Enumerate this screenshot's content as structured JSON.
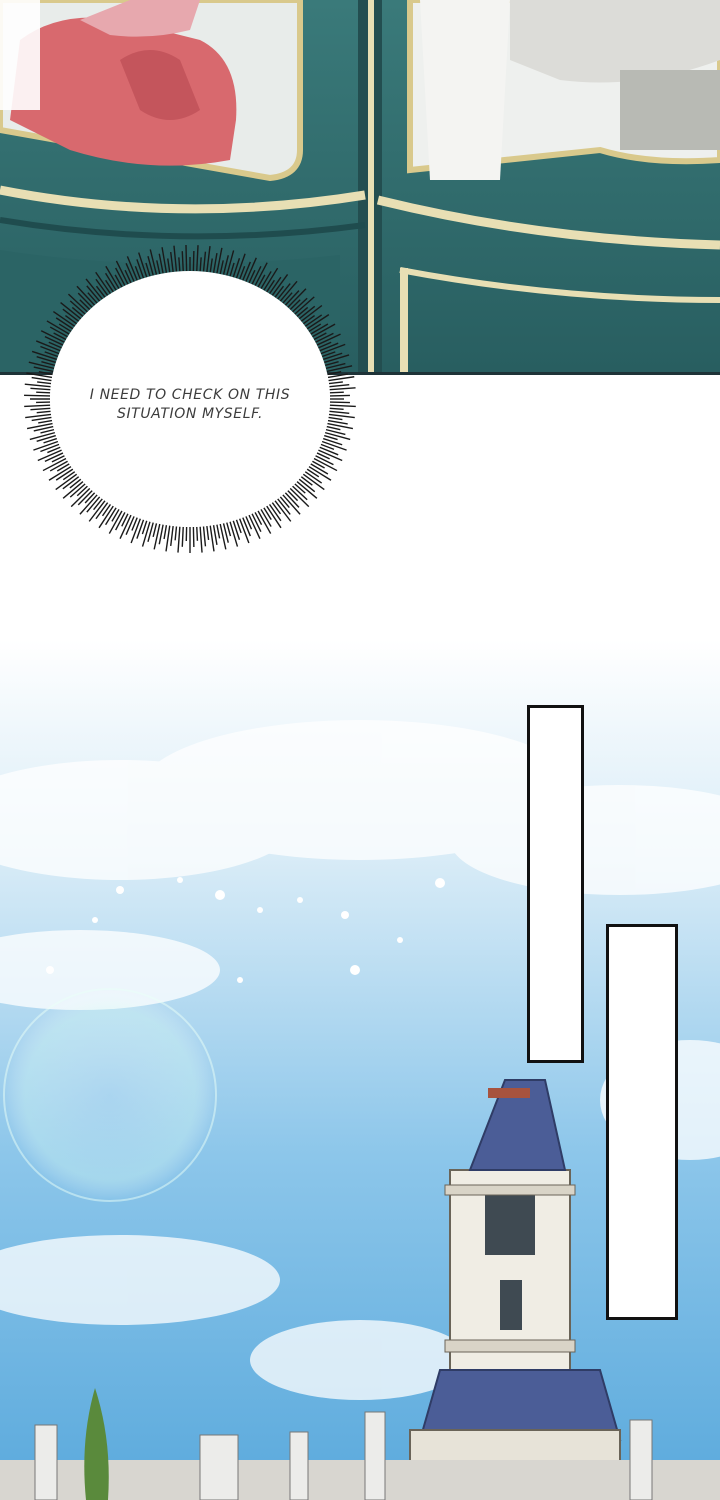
{
  "panels": [
    {
      "id": "carriage-interior",
      "speech": {
        "text": "I NEED TO CHECK ON THIS SITUATION MYSELF."
      }
    },
    {
      "id": "sky-castle",
      "captions": [
        {
          "text": ""
        },
        {
          "text": ""
        }
      ]
    }
  ],
  "colors": {
    "carriage_teal": "#2f6a6b",
    "carriage_trim": "#e8dfb4",
    "sky_top": "#ffffff",
    "sky_bottom": "#62aede",
    "castle_roof": "#4b5d97"
  },
  "icons": [
    "lens-flare",
    "sparkle"
  ]
}
